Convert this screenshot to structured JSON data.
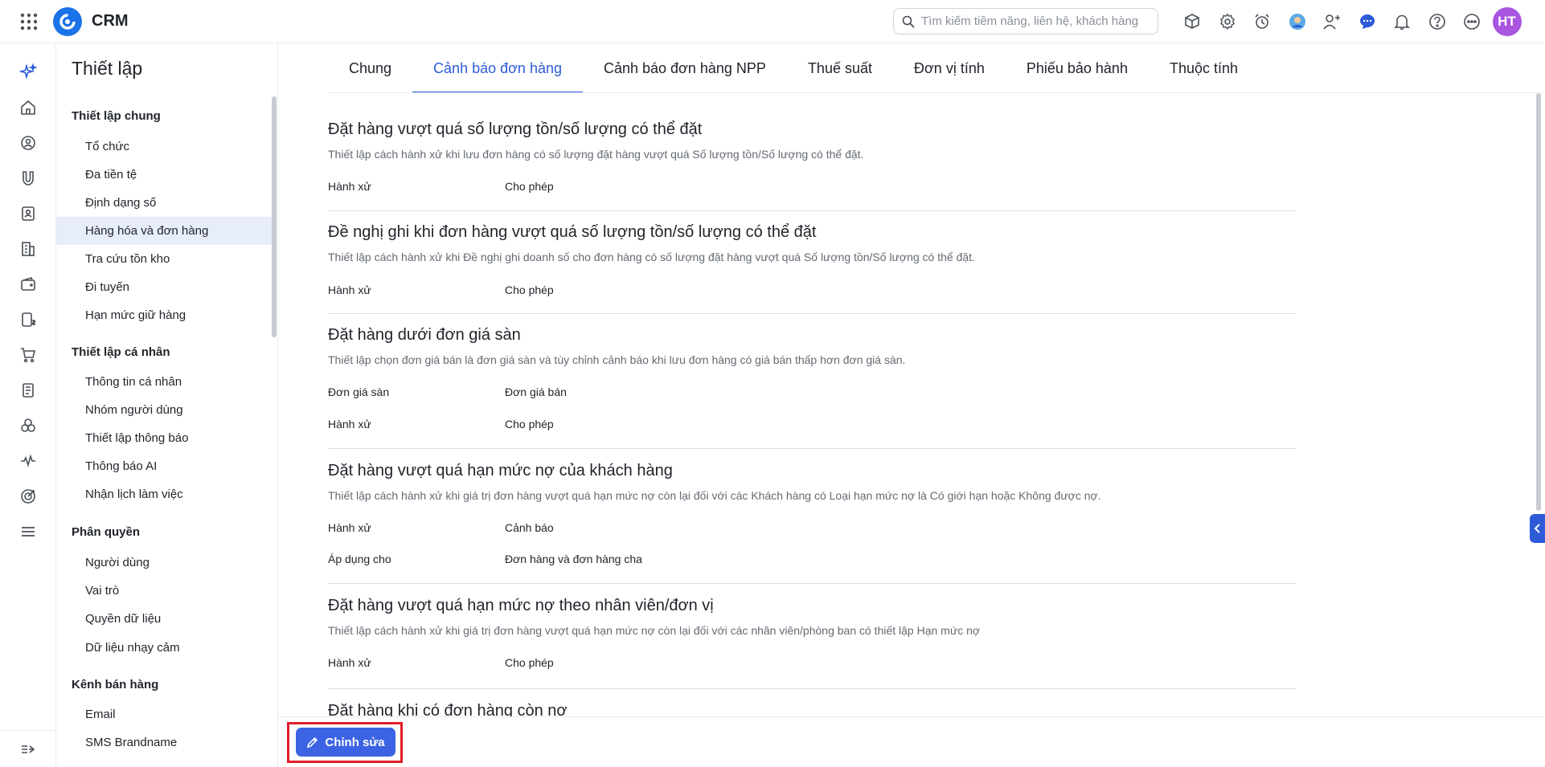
{
  "app": {
    "title": "CRM"
  },
  "search": {
    "placeholder": "Tìm kiếm tiềm năng, liên hệ, khách hàng"
  },
  "user": {
    "initials": "HT"
  },
  "sidebar": {
    "title": "Thiết lập",
    "groups": [
      {
        "title": "Thiết lập chung",
        "items": [
          "Tổ chức",
          "Đa tiền tệ",
          "Định dạng số",
          "Hàng hóa và đơn hàng",
          "Tra cứu tồn kho",
          "Đi tuyến",
          "Hạn mức giữ hàng"
        ]
      },
      {
        "title": "Thiết lập cá nhân",
        "items": [
          "Thông tin cá nhân",
          "Nhóm người dùng",
          "Thiết lập thông báo",
          "Thông báo AI",
          "Nhận lịch làm việc"
        ]
      },
      {
        "title": "Phân quyền",
        "items": [
          "Người dùng",
          "Vai trò",
          "Quyền dữ liệu",
          "Dữ liệu nhạy cảm"
        ]
      },
      {
        "title": "Kênh bán hàng",
        "items": [
          "Email",
          "SMS Brandname"
        ]
      }
    ],
    "active_item": "Hàng hóa và đơn hàng"
  },
  "tabs": [
    "Chung",
    "Cảnh báo đơn hàng",
    "Cảnh báo đơn hàng NPP",
    "Thuế suất",
    "Đơn vị tính",
    "Phiếu bảo hành",
    "Thuộc tính"
  ],
  "active_tab": "Cảnh báo đơn hàng",
  "sections": [
    {
      "title": "Đặt hàng vượt quá số lượng tồn/số lượng có thể đặt",
      "description": "Thiết lập cách hành xử khi lưu đơn hàng có số lượng đặt hàng vượt quá Số lượng tồn/Số lượng có thể đặt.",
      "rows": [
        {
          "label": "Hành xử",
          "value": "Cho phép"
        }
      ]
    },
    {
      "title": "Đề nghị ghi khi đơn hàng vượt quá số lượng tồn/số lượng có thể đặt",
      "description": "Thiết lập cách hành xử khi Đề nghị ghi doanh số cho đơn hàng có số lượng đặt hàng vượt quá Số lượng tồn/Số lượng có thể đặt.",
      "rows": [
        {
          "label": "Hành xử",
          "value": "Cho phép"
        }
      ]
    },
    {
      "title": "Đặt hàng dưới đơn giá sàn",
      "description": "Thiết lập chọn đơn giá bán là đơn giá sàn và tùy chỉnh cảnh báo khi lưu đơn hàng có giá bán thấp hơn đơn giá sàn.",
      "rows": [
        {
          "label": "Đơn giá sàn",
          "value": "Đơn giá bán"
        },
        {
          "label": "Hành xử",
          "value": "Cho phép"
        }
      ]
    },
    {
      "title": "Đặt hàng vượt quá hạn mức nợ của khách hàng",
      "description": "Thiết lập cách hành xử khi giá trị đơn hàng vượt quá hạn mức nợ còn lại đối với các Khách hàng có Loại hạn mức nợ là Có giới hạn hoặc Không được nợ.",
      "rows": [
        {
          "label": "Hành xử",
          "value": "Cảnh báo"
        },
        {
          "label": "Áp dụng cho",
          "value": "Đơn hàng và đơn hàng cha"
        }
      ]
    },
    {
      "title": "Đặt hàng vượt quá hạn mức nợ theo nhân viên/đơn vị",
      "description": "Thiết lập cách hành xử khi giá trị đơn hàng vượt quá hạn mức nợ còn lại đối với các nhân viên/phòng ban có thiết lập Hạn mức nợ",
      "rows": [
        {
          "label": "Hành xử",
          "value": "Cho phép"
        }
      ]
    },
    {
      "title": "Đặt hàng khi có đơn hàng còn nợ",
      "description": "",
      "rows": []
    }
  ],
  "footer": {
    "edit_label": "Chỉnh sửa"
  },
  "colors": {
    "accent": "#2d5bd8",
    "button": "#3b63e3",
    "highlight": "#e11d2a",
    "avatar": "#a855e0"
  }
}
